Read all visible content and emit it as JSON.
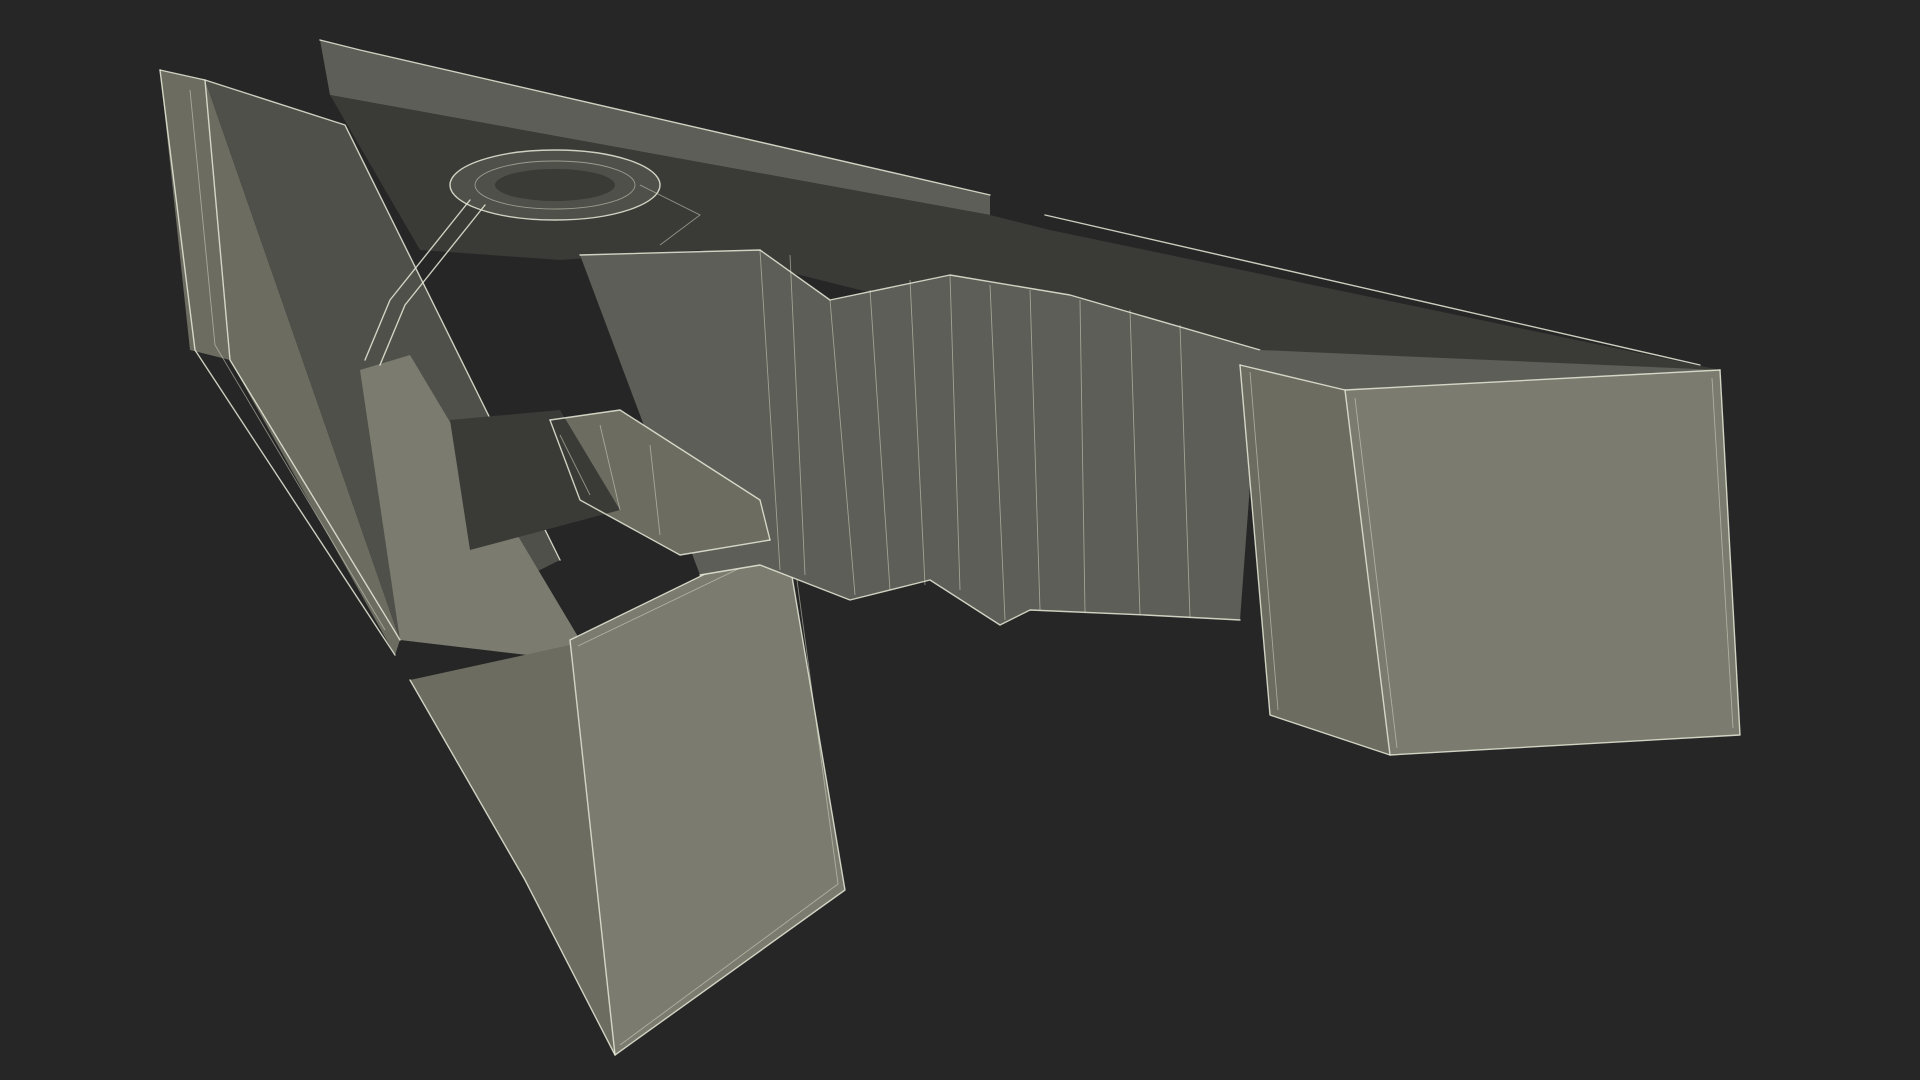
{
  "scene": {
    "background_color": "#262626",
    "model_color": "#7b7b6f",
    "wireframe_color": "#e8ead8",
    "subject": "clothespin-wireframe-model"
  }
}
